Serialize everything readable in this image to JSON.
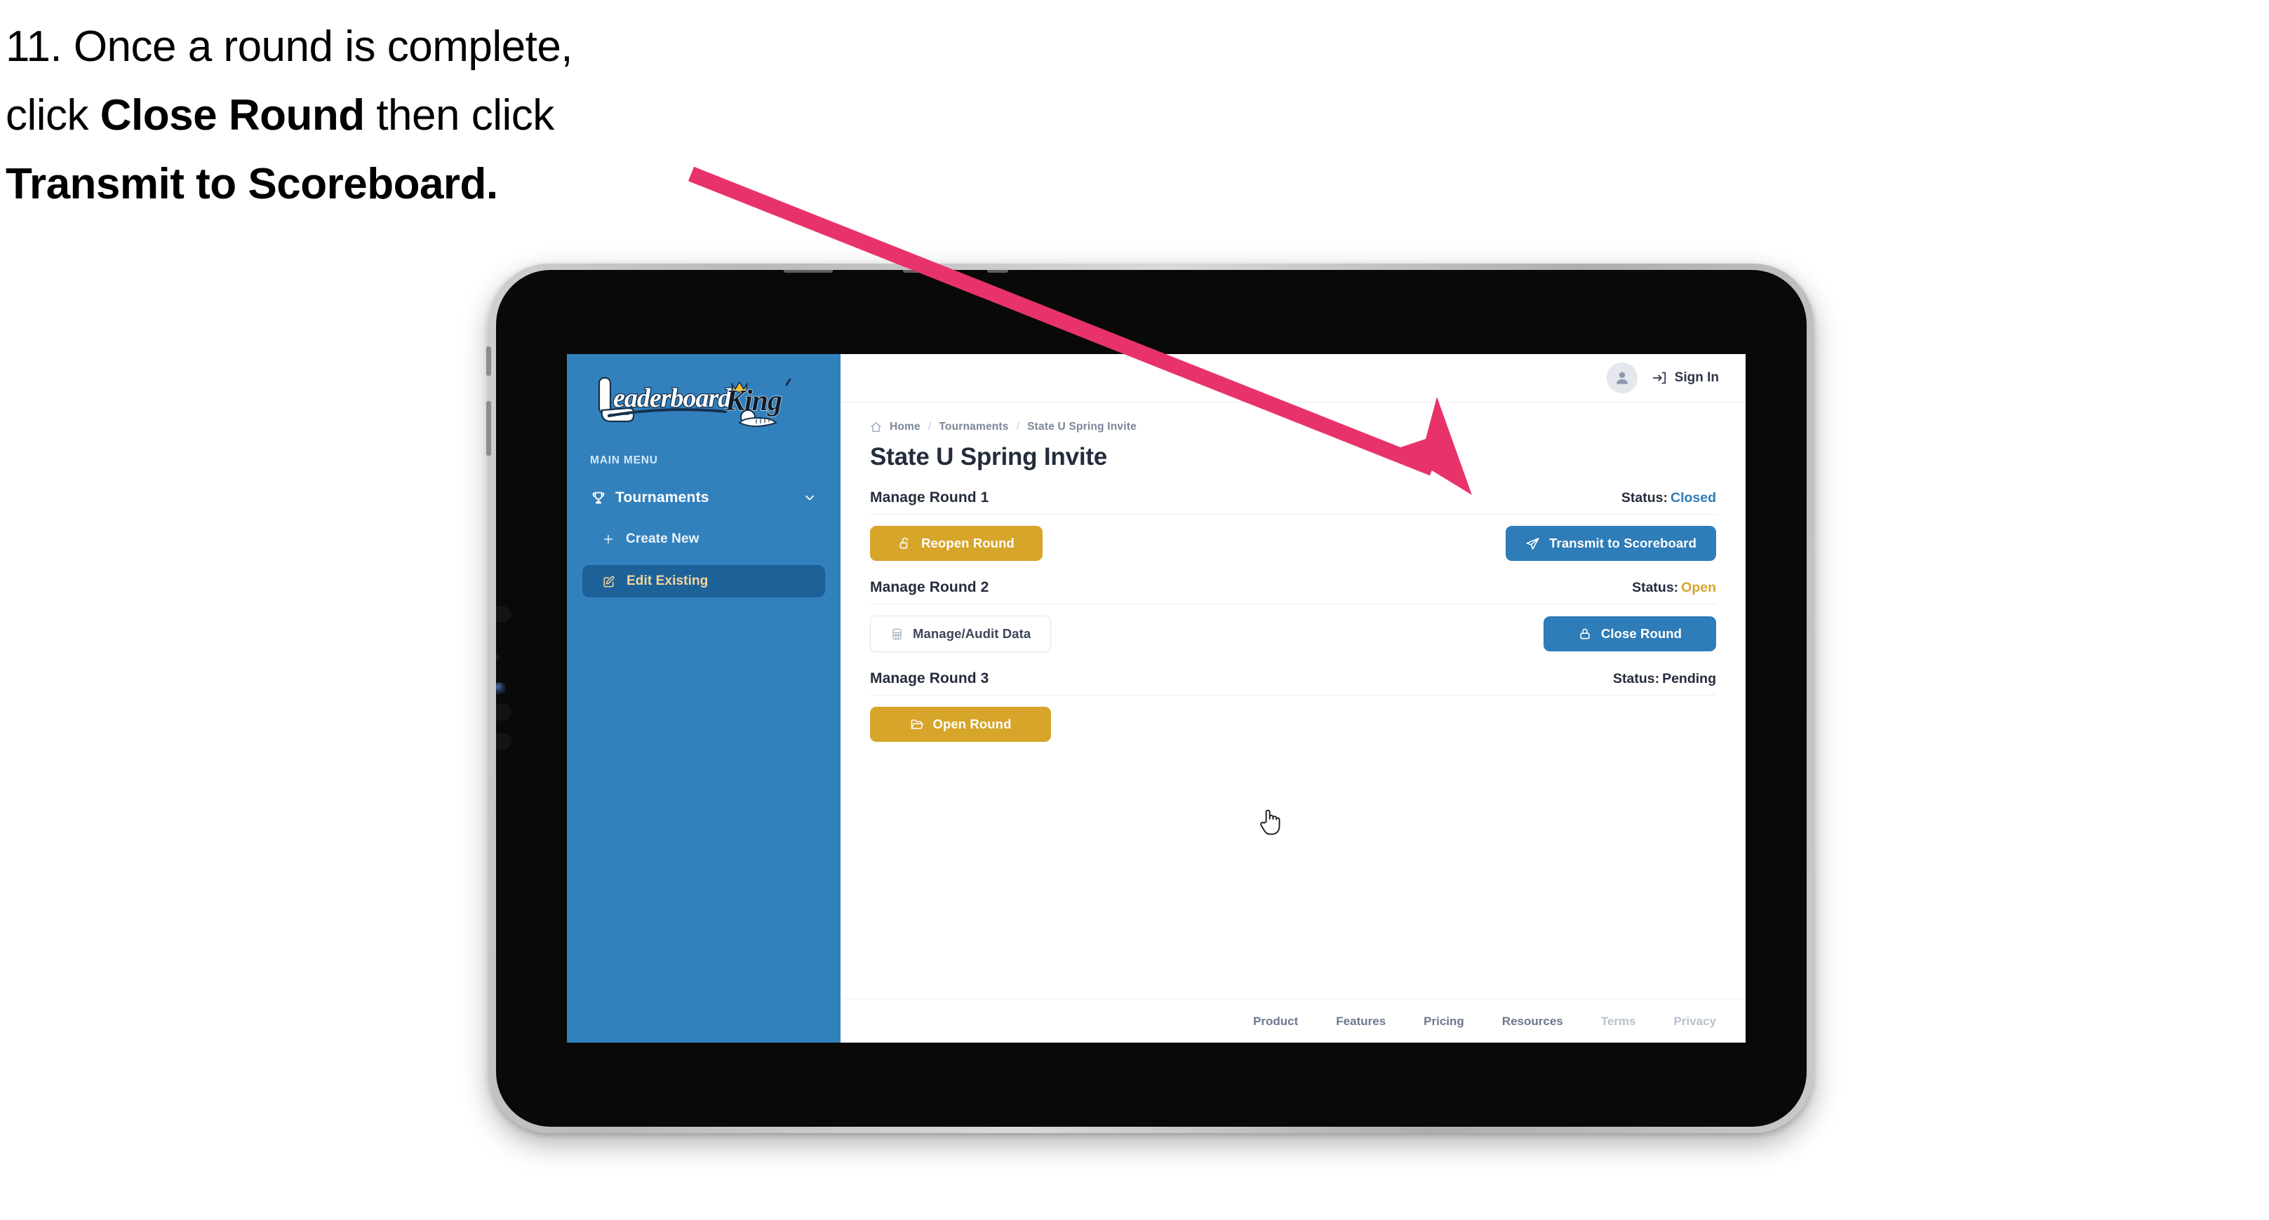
{
  "caption": {
    "line1_plain": "11. Once a round is complete,",
    "line2_pre": "click ",
    "line2_bold": "Close Round",
    "line2_post": " then click",
    "line3_bold": "Transmit to Scoreboard."
  },
  "app": {
    "sidebar": {
      "logo_text_left": "Leaderboard",
      "logo_text_right": "King",
      "section_label": "MAIN MENU",
      "nav": [
        {
          "label": "Tournaments",
          "icon": "trophy-icon",
          "chevron": "chevron-down-icon",
          "active": false
        },
        {
          "label": "Create New",
          "icon": "plus-icon",
          "active": false
        },
        {
          "label": "Edit Existing",
          "icon": "pencil-square-icon",
          "active": true
        }
      ]
    },
    "topbar": {
      "avatar_icon": "user-avatar-icon",
      "signin_icon": "sign-in-icon",
      "signin_label": "Sign In"
    },
    "breadcrumb": {
      "home_icon": "home-icon",
      "items": [
        "Home",
        "Tournaments",
        "State U Spring Invite"
      ],
      "separator": "/"
    },
    "page_title": "State U Spring Invite",
    "rounds": [
      {
        "title": "Manage Round 1",
        "status_label": "Status:",
        "status_value": "Closed",
        "status_color": "#2e7cb8",
        "left_button": {
          "label": "Reopen Round",
          "icon": "unlock-icon",
          "style": "gold"
        },
        "right_button": {
          "label": "Transmit to Scoreboard",
          "icon": "paper-plane-icon",
          "style": "blue"
        }
      },
      {
        "title": "Manage Round 2",
        "status_label": "Status:",
        "status_value": "Open",
        "status_color": "#d9a42c",
        "left_button": {
          "label": "Manage/Audit Data",
          "icon": "table-grid-icon",
          "style": "ghost"
        },
        "right_button": {
          "label": "Close Round",
          "icon": "lock-icon",
          "style": "blue"
        }
      },
      {
        "title": "Manage Round 3",
        "status_label": "Status:",
        "status_value": "Pending",
        "status_color": "#242c3d",
        "left_button": {
          "label": "Open Round",
          "icon": "folder-open-icon",
          "style": "gold"
        },
        "right_button": null
      }
    ],
    "footer_links": [
      {
        "label": "Product",
        "muted": false
      },
      {
        "label": "Features",
        "muted": false
      },
      {
        "label": "Pricing",
        "muted": false
      },
      {
        "label": "Resources",
        "muted": false
      },
      {
        "label": "Terms",
        "muted": true
      },
      {
        "label": "Privacy",
        "muted": true
      }
    ]
  },
  "annotation": {
    "arrow_color": "#e8336a",
    "cursor_icon": "pointing-hand-cursor"
  },
  "colors": {
    "sidebar_blue": "#3281bd",
    "sidebar_active": "#1d6199",
    "accent_gold": "#d6a52a",
    "accent_blue": "#2e7cb8",
    "text_dark": "#242c3d"
  }
}
